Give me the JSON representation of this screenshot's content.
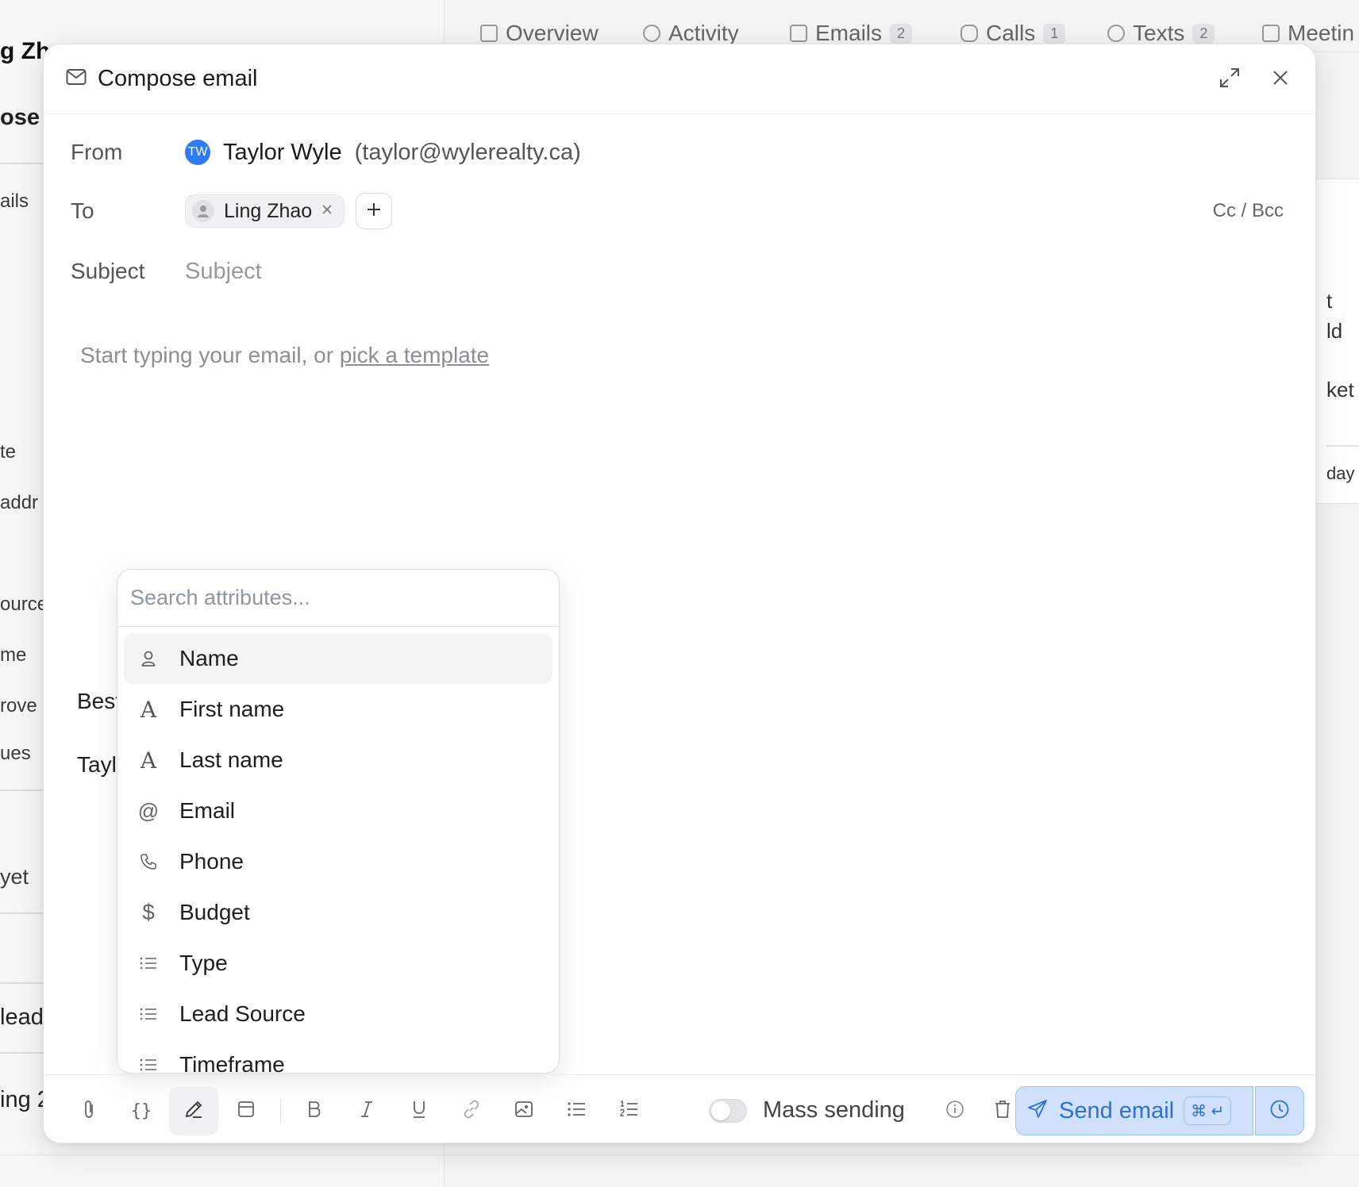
{
  "background": {
    "left_fragments": [
      "g Zh",
      "ose",
      "ails",
      "te",
      "addr",
      "ource",
      "me",
      "rove",
      "ues",
      "yet",
      "lead",
      "ing 2"
    ],
    "tabs": [
      {
        "label": "Overview",
        "count": ""
      },
      {
        "label": "Activity",
        "count": ""
      },
      {
        "label": "Emails",
        "count": "2"
      },
      {
        "label": "Calls",
        "count": "1"
      },
      {
        "label": "Texts",
        "count": "2"
      },
      {
        "label": "Meetin",
        "count": ""
      }
    ],
    "right_fragments": [
      "t",
      "ld",
      "ket",
      "day"
    ]
  },
  "modal": {
    "title": "Compose email",
    "from_label": "From",
    "from_initials": "TW",
    "from_name": "Taylor Wyle",
    "from_email": "(taylor@wylerealty.ca)",
    "to_label": "To",
    "to_recipient": "Ling Zhao",
    "cc_bcc": "Cc / Bcc",
    "subject_label": "Subject",
    "subject_placeholder": "Subject",
    "body_placeholder": "Start typing your email, or ",
    "body_link": "pick a template",
    "signature_fragments": [
      "Best",
      "Tayl"
    ]
  },
  "attributes": {
    "search_placeholder": "Search attributes...",
    "items": [
      {
        "label": "Name",
        "icon": "person-icon"
      },
      {
        "label": "First name",
        "icon": "text-a-icon"
      },
      {
        "label": "Last name",
        "icon": "text-a-icon"
      },
      {
        "label": "Email",
        "icon": "at-icon"
      },
      {
        "label": "Phone",
        "icon": "phone-icon"
      },
      {
        "label": "Budget",
        "icon": "dollar-icon"
      },
      {
        "label": "Type",
        "icon": "list-icon"
      },
      {
        "label": "Lead Source",
        "icon": "list-icon"
      },
      {
        "label": "Timeframe",
        "icon": "list-icon"
      }
    ]
  },
  "footer": {
    "mass_sending": "Mass sending",
    "send_label": "Send email",
    "shortcut": "⌘ ↵"
  },
  "colors": {
    "accent": "#2f6fd6",
    "send_bg": "#cfe1fb",
    "avatar": "#2f7bf5"
  }
}
